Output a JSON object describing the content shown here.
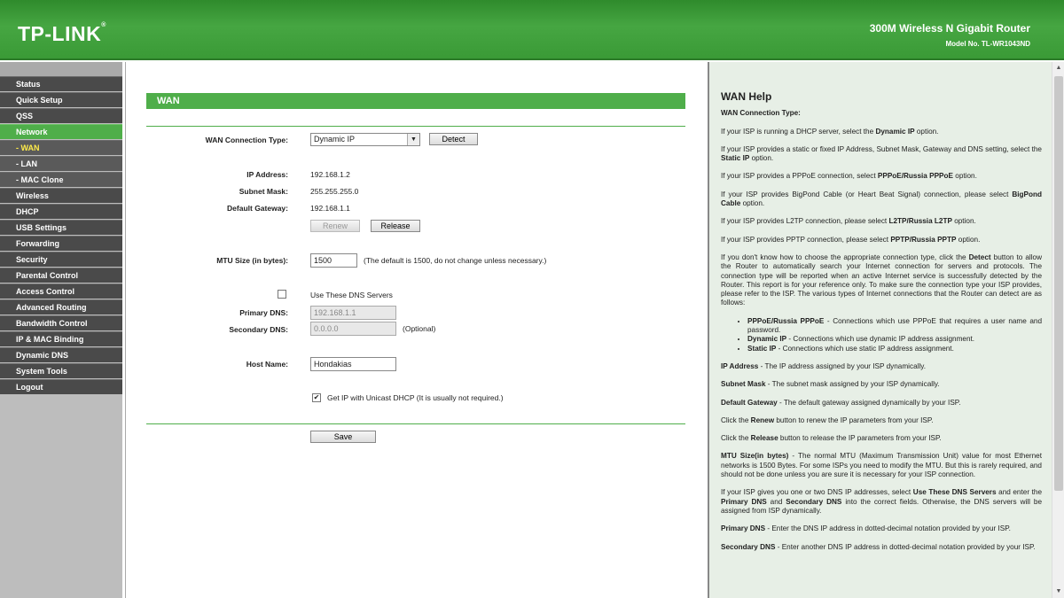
{
  "header": {
    "logo": "TP-LINK",
    "product_name": "300M Wireless N Gigabit Router",
    "model": "Model No. TL-WR1043ND"
  },
  "sidebar": {
    "items": [
      {
        "label": "Status"
      },
      {
        "label": "Quick Setup"
      },
      {
        "label": "QSS"
      },
      {
        "label": "Network"
      },
      {
        "label": "- WAN"
      },
      {
        "label": "- LAN"
      },
      {
        "label": "- MAC Clone"
      },
      {
        "label": "Wireless"
      },
      {
        "label": "DHCP"
      },
      {
        "label": "USB Settings"
      },
      {
        "label": "Forwarding"
      },
      {
        "label": "Security"
      },
      {
        "label": "Parental Control"
      },
      {
        "label": "Access Control"
      },
      {
        "label": "Advanced Routing"
      },
      {
        "label": "Bandwidth Control"
      },
      {
        "label": "IP & MAC Binding"
      },
      {
        "label": "Dynamic DNS"
      },
      {
        "label": "System Tools"
      },
      {
        "label": "Logout"
      }
    ]
  },
  "wan": {
    "section_title": "WAN",
    "conn_type_label": "WAN Connection Type:",
    "conn_type_value": "Dynamic IP",
    "detect_label": "Detect",
    "ip_label": "IP Address:",
    "ip_value": "192.168.1.2",
    "mask_label": "Subnet Mask:",
    "mask_value": "255.255.255.0",
    "gateway_label": "Default Gateway:",
    "gateway_value": "192.168.1.1",
    "renew_label": "Renew",
    "release_label": "Release",
    "mtu_label": "MTU Size (in bytes):",
    "mtu_value": "1500",
    "mtu_note": "(The default is 1500, do not change unless necessary.)",
    "use_dns_label": "Use These DNS Servers",
    "primary_dns_label": "Primary DNS:",
    "primary_dns_value": "192.168.1.1",
    "secondary_dns_label": "Secondary DNS:",
    "secondary_dns_value": "0.0.0.0",
    "optional_label": "(Optional)",
    "host_name_label": "Host Name:",
    "host_name_value": "Hondakias",
    "unicast_label": "Get IP with Unicast DHCP (It is usually not required.)",
    "save_label": "Save"
  },
  "help": {
    "title": "WAN Help",
    "conn_type_heading": "WAN Connection Type:",
    "p_dhcp_a": "If your ISP is running a DHCP server, select the ",
    "p_dhcp_b": "Dynamic IP",
    "p_dhcp_c": " option.",
    "p_static_a": "If your ISP provides a static or fixed IP Address, Subnet Mask, Gateway and DNS setting, select the ",
    "p_static_b": "Static IP",
    "p_static_c": " option.",
    "p_pppoe_a": "If your ISP provides a PPPoE connection, select ",
    "p_pppoe_b": "PPPoE/Russia PPPoE",
    "p_pppoe_c": " option.",
    "p_bigpond_a": "If your ISP provides BigPond Cable (or Heart Beat Signal) connection, please select ",
    "p_bigpond_b": "BigPond Cable",
    "p_bigpond_c": " option.",
    "p_l2tp_a": "If your ISP provides L2TP connection, please select ",
    "p_l2tp_b": "L2TP/Russia L2TP",
    "p_l2tp_c": " option.",
    "p_pptp_a": "If your ISP provides PPTP connection, please select ",
    "p_pptp_b": "PPTP/Russia PPTP",
    "p_pptp_c": " option.",
    "p_detect_a": "If you don't know how to choose the appropriate connection type, click the ",
    "p_detect_b": "Detect",
    "p_detect_c": " button to allow the Router to automatically search your Internet connection for servers and protocols. The connection type will be reported when an active Internet service is successfully detected by the Router. This report is for your reference only. To make sure the connection type your ISP provides, please refer to the ISP. The various types of Internet connections that the Router can detect are as follows:",
    "li1_a": "PPPoE/Russia PPPoE",
    "li1_b": " - Connections which use PPPoE that requires a user name and password.",
    "li2_a": "Dynamic IP",
    "li2_b": " - Connections which use dynamic IP address assignment.",
    "li3_a": "Static IP",
    "li3_b": " - Connections which use static IP address assignment.",
    "p_ip_a": "IP Address",
    "p_ip_b": " - The IP address assigned by your ISP dynamically.",
    "p_mask_a": "Subnet Mask",
    "p_mask_b": " - The subnet mask assigned by your ISP dynamically.",
    "p_gw_a": "Default Gateway",
    "p_gw_b": " - The default gateway assigned dynamically by your ISP.",
    "p_renew_a": "Click the ",
    "p_renew_b": "Renew",
    "p_renew_c": " button to renew the IP parameters from your ISP.",
    "p_release_a": "Click the ",
    "p_release_b": "Release",
    "p_release_c": " button to release the IP parameters from your ISP.",
    "p_mtu_a": "MTU Size(in bytes)",
    "p_mtu_b": " - The normal MTU (Maximum Transmission Unit) value for most Ethernet networks is 1500 Bytes. For some ISPs you need to modify the MTU. But this is rarely required, and should not be done unless you are sure it is necessary for your ISP connection.",
    "p_dns_a": "If your ISP gives you one or two DNS IP addresses, select ",
    "p_dns_b": "Use These DNS Servers",
    "p_dns_c": " and enter the ",
    "p_dns_d": "Primary DNS",
    "p_dns_e": " and ",
    "p_dns_f": "Secondary DNS",
    "p_dns_g": " into the correct fields. Otherwise, the DNS servers will be assigned from ISP dynamically.",
    "p_pdns_a": "Primary DNS",
    "p_pdns_b": " - Enter the DNS IP address in dotted-decimal notation provided by your ISP.",
    "p_sdns_a": "Secondary DNS",
    "p_sdns_b": " - Enter another DNS IP address in dotted-decimal notation provided by your ISP."
  }
}
